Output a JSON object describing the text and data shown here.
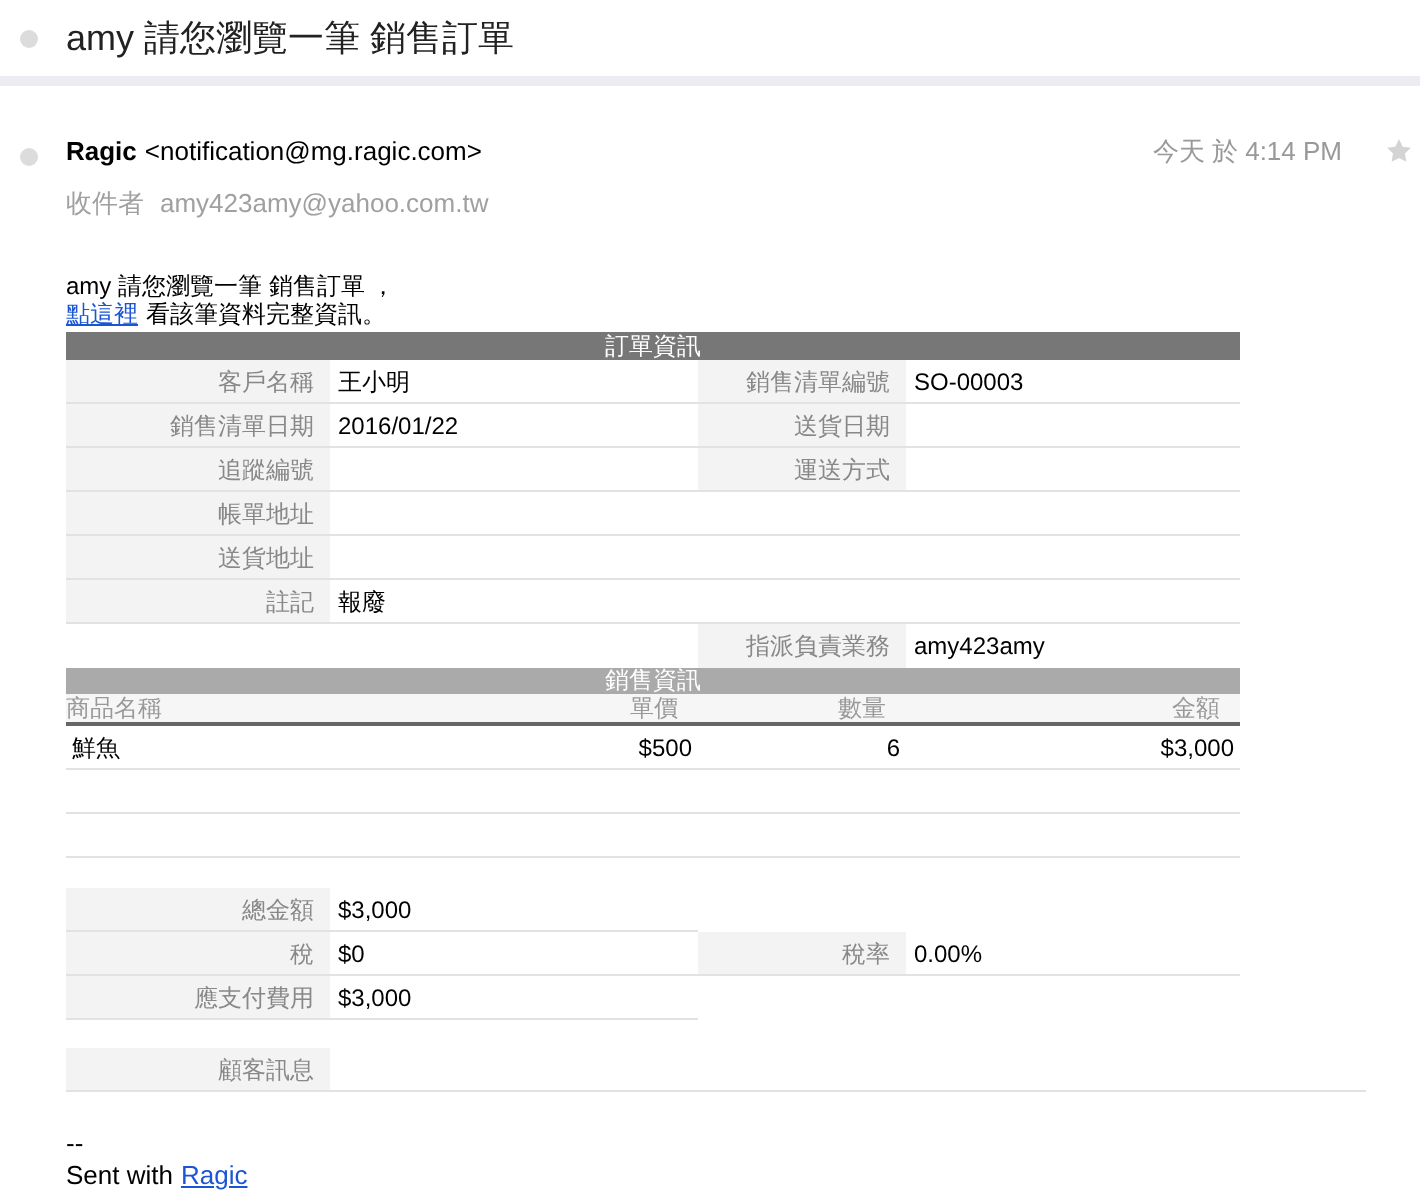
{
  "subject": "amy 請您瀏覽一筆 銷售訂單",
  "message": {
    "sender_name": "Ragic",
    "sender_email": "<notification@mg.ragic.com>",
    "time": "今天 於 4:14 PM",
    "to_label": "收件者",
    "to": "amy423amy@yahoo.com.tw",
    "starred": false
  },
  "body": {
    "intro": "amy 請您瀏覽一筆 銷售訂單 ，",
    "link": "點這裡",
    "link_suffix": "看該筆資料完整資訊。"
  },
  "order_info": {
    "title": "訂單資訊",
    "rows": [
      {
        "kind": "pair",
        "left": {
          "label": "客戶名稱",
          "value": "王小明"
        },
        "right": {
          "label": "銷售清單編號",
          "value": "SO-00003"
        }
      },
      {
        "kind": "pair",
        "left": {
          "label": "銷售清單日期",
          "value": "2016/01/22"
        },
        "right": {
          "label": "送貨日期"
        }
      },
      {
        "kind": "pair",
        "left": {
          "label": "追蹤編號"
        },
        "right": {
          "label": "運送方式"
        }
      },
      {
        "kind": "full",
        "left": {
          "label": "帳單地址"
        }
      },
      {
        "kind": "full",
        "left": {
          "label": "送貨地址"
        }
      },
      {
        "kind": "full",
        "left": {
          "label": "註記",
          "value": "報廢"
        }
      },
      {
        "kind": "right",
        "right": {
          "label": "指派負責業務",
          "value": "amy423amy"
        }
      }
    ]
  },
  "sales_info": {
    "title": "銷售資訊",
    "columns": [
      {
        "label": "商品名稱"
      },
      {
        "label": "單價"
      },
      {
        "label": "數量"
      },
      {
        "label": "金額"
      }
    ],
    "rows": [
      {
        "kind": "item",
        "cells": [
          "鮮魚",
          "$500",
          "6",
          "$3,000"
        ]
      },
      {
        "kind": "empty"
      },
      {
        "kind": "empty"
      }
    ]
  },
  "totals": {
    "rows": [
      {
        "kind": "left",
        "left": {
          "label": "總金額",
          "value": "$3,000"
        }
      },
      {
        "kind": "pair",
        "left": {
          "label": "稅",
          "value": "$0"
        },
        "right": {
          "label": "稅率",
          "value": "0.00%"
        }
      },
      {
        "kind": "left",
        "left": {
          "label": "應支付費用",
          "value": "$3,000"
        }
      }
    ]
  },
  "customer_message": {
    "label": "顧客訊息"
  },
  "footer": {
    "separator": "--",
    "text": "Sent with",
    "link": "Ragic"
  }
}
